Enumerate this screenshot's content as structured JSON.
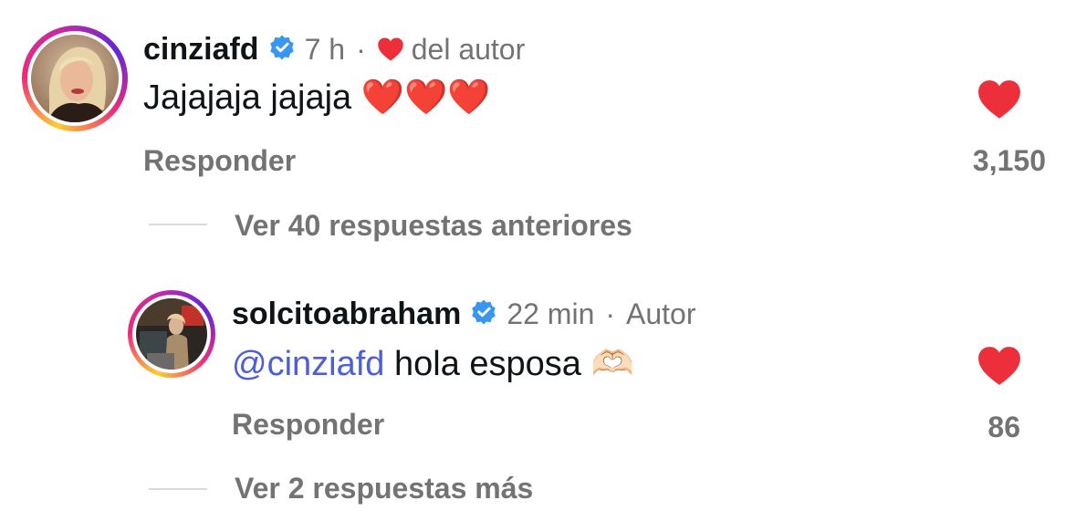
{
  "colors": {
    "like_red": "#ed2f3b",
    "verified_blue": "#3797f0",
    "mention_blue": "#4c5fd7",
    "muted_text": "#737373"
  },
  "comments": [
    {
      "username": "cinziafd",
      "verified": true,
      "time": "7 h",
      "separator": "·",
      "author_like_icon": "heart-icon",
      "author_like_label": "del autor",
      "text": "Jajajaja jajaja ❤️❤️❤️",
      "reply_label": "Responder",
      "like_count": "3,150",
      "liked": true,
      "view_replies_label": "Ver 40 respuestas anteriores"
    },
    {
      "username": "solcitoabraham",
      "verified": true,
      "time": "22 min",
      "separator": "·",
      "author_label": "Autor",
      "mention": "@cinziafd",
      "text": "hola esposa 🫶🏻",
      "reply_label": "Responder",
      "like_count": "86",
      "liked": true,
      "view_replies_label": "Ver 2 respuestas más"
    }
  ]
}
